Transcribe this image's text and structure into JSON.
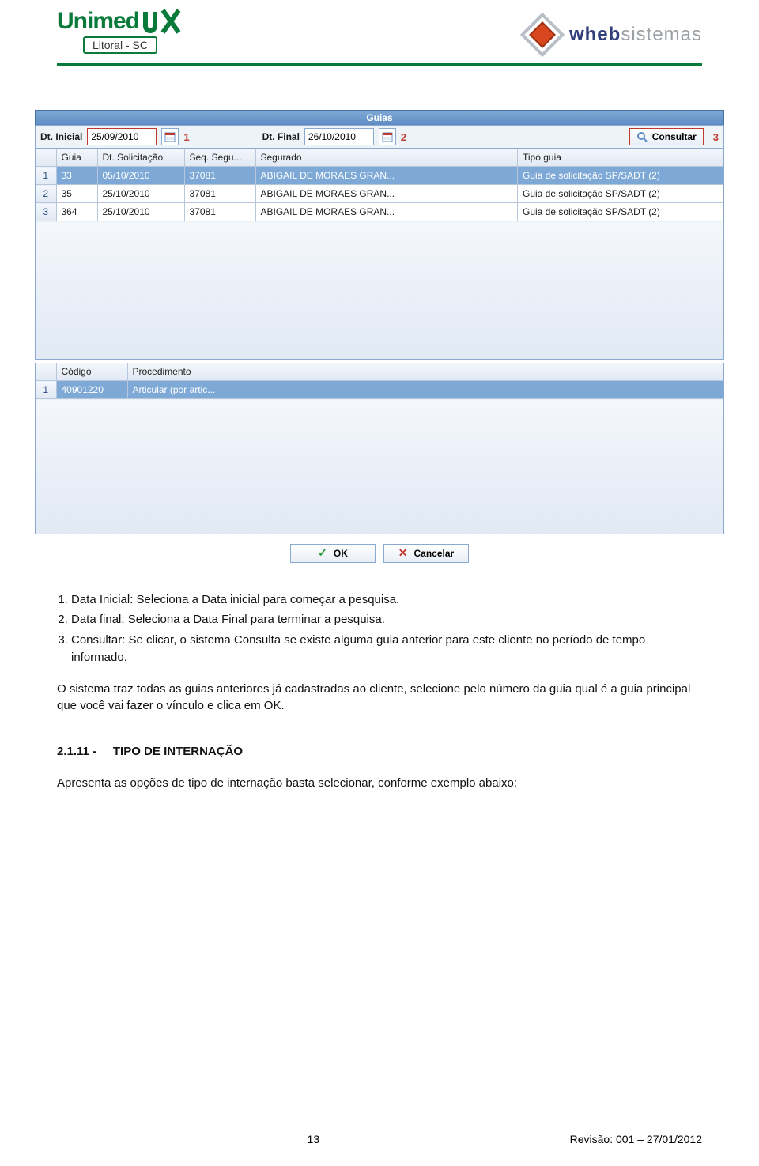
{
  "header": {
    "unimed_brand": "Unimed",
    "unimed_sub": "Litoral - SC",
    "wheb_blue": "wheb",
    "wheb_gray": "sistemas"
  },
  "app": {
    "title": "Guias",
    "filter": {
      "label_start": "Dt. Inicial",
      "value_start": "25/09/2010",
      "ann1": "1",
      "label_end": "Dt. Final",
      "value_end": "26/10/2010",
      "ann2": "2",
      "consultar": "Consultar",
      "ann3": "3"
    },
    "columns_top": [
      "",
      "Guia",
      "Dt. Solicitação",
      "Seq. Segu...",
      "Segurado",
      "Tipo guia"
    ],
    "rows_top": [
      {
        "n": "1",
        "guia": "33",
        "dt": "05/10/2010",
        "seq": "37081",
        "seg": "ABIGAIL DE MORAES GRAN...",
        "tipo": "Guia de solicitação SP/SADT (2)",
        "sel": true
      },
      {
        "n": "2",
        "guia": "35",
        "dt": "25/10/2010",
        "seq": "37081",
        "seg": "ABIGAIL DE MORAES GRAN...",
        "tipo": "Guia de solicitação SP/SADT (2)",
        "sel": false
      },
      {
        "n": "3",
        "guia": "364",
        "dt": "25/10/2010",
        "seq": "37081",
        "seg": "ABIGAIL DE MORAES GRAN...",
        "tipo": "Guia de solicitação SP/SADT (2)",
        "sel": false
      }
    ],
    "columns_bot": [
      "",
      "Código",
      "Procedimento"
    ],
    "rows_bot": [
      {
        "n": "1",
        "cod": "40901220",
        "proc": "Articular (por artic...",
        "sel": true
      }
    ],
    "btn_ok": "OK",
    "btn_cancel": "Cancelar"
  },
  "doc": {
    "step1": "Data Inicial: Seleciona a Data inicial para começar a pesquisa.",
    "step2": "Data final: Seleciona a Data Final para terminar a pesquisa.",
    "step3": "Consultar: Se clicar, o sistema Consulta se existe alguma guia anterior para este cliente no período de tempo informado.",
    "para1": "O sistema traz todas as guias anteriores já cadastradas ao cliente, selecione pelo número da guia qual é a guia principal que você vai fazer o vínculo e clica em OK.",
    "section_no": "2.1.11 -",
    "section_title": "TIPO DE INTERNAÇÃO",
    "para2": "Apresenta as opções de tipo de internação basta selecionar, conforme exemplo abaixo:"
  },
  "footer": {
    "page": "13",
    "rev": "Revisão: 001 – 27/01/2012"
  }
}
